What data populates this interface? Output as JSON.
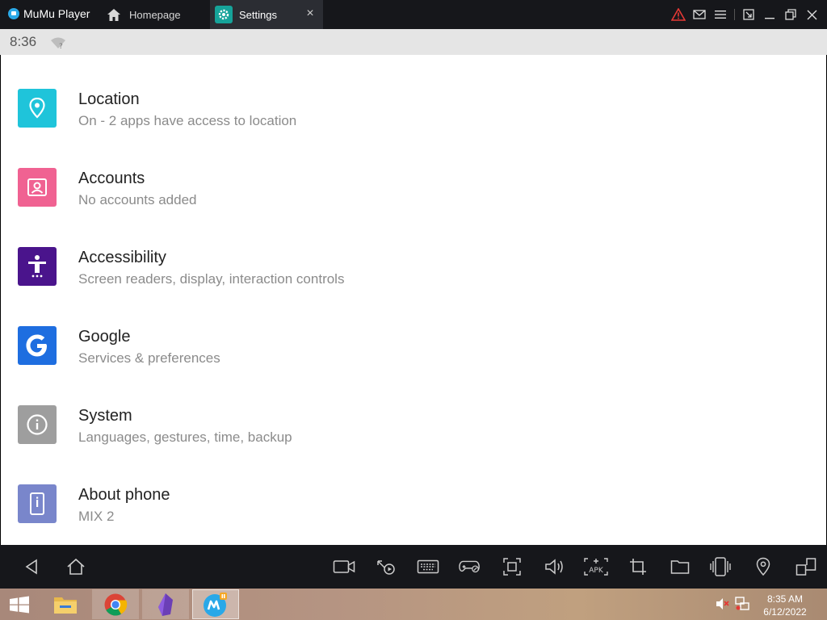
{
  "titlebar": {
    "app_title": "MuMu Player",
    "tabs": [
      {
        "label": "Homepage",
        "icon": "home-icon"
      },
      {
        "label": "Settings",
        "icon": "gear-icon"
      }
    ]
  },
  "statusbar": {
    "time": "8:36",
    "wifi_icon": "wifi-icon"
  },
  "settings": {
    "items": [
      {
        "title": "Location",
        "subtitle": "On - 2 apps have access to location",
        "icon": "location-pin-icon",
        "color": "#1fc4da"
      },
      {
        "title": "Accounts",
        "subtitle": "No accounts added",
        "icon": "account-icon",
        "color": "#f06292"
      },
      {
        "title": "Accessibility",
        "subtitle": "Screen readers, display, interaction controls",
        "icon": "accessibility-icon",
        "color": "#4a148c"
      },
      {
        "title": "Google",
        "subtitle": "Services & preferences",
        "icon": "google-icon",
        "color": "#1e6ee0"
      },
      {
        "title": "System",
        "subtitle": "Languages, gestures, time, backup",
        "icon": "info-icon",
        "color": "#9e9e9e"
      },
      {
        "title": "About phone",
        "subtitle": "MIX 2",
        "icon": "phone-icon",
        "color": "#7986cb"
      }
    ]
  },
  "toolbar": {
    "left": [
      "back-icon",
      "home-icon"
    ],
    "right": [
      "video-record-icon",
      "operation-record-icon",
      "keyboard-icon",
      "gamepad-icon",
      "screenshot-icon",
      "volume-icon",
      "apk-install-icon",
      "crop-icon",
      "folder-icon",
      "shake-icon",
      "location-icon",
      "multi-window-icon"
    ],
    "apk_label": "APK"
  },
  "taskbar": {
    "apps": [
      "file-explorer-icon",
      "chrome-icon",
      "obsidian-icon",
      "mumu-player-icon"
    ],
    "time": "8:35 AM",
    "date": "6/12/2022"
  },
  "colors": {
    "titlebar_bg": "#16171b",
    "warning": "#e53935"
  }
}
